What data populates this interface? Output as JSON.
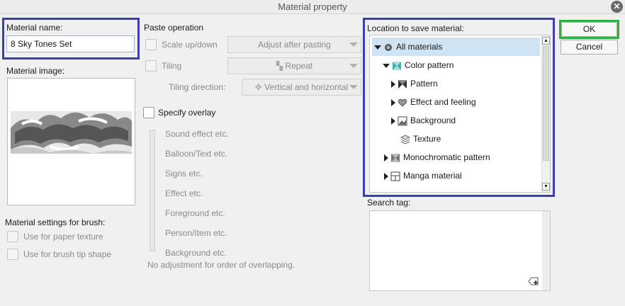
{
  "window": {
    "title": "Material property"
  },
  "material_name": {
    "label": "Material name:",
    "value": "8 Sky Tones Set"
  },
  "material_image": {
    "label": "Material image:"
  },
  "brush_settings": {
    "label": "Material settings for brush:",
    "paper_texture": "Use for paper texture",
    "brush_tip": "Use for brush tip shape"
  },
  "paste": {
    "label": "Paste operation",
    "scale_label": "Scale up/down",
    "scale_dropdown": "Adjust after pasting",
    "tiling_label": "Tiling",
    "tiling_dropdown": "Repeat",
    "direction_label": "Tiling direction:",
    "direction_dropdown": "Vertical and horizontal"
  },
  "overlay": {
    "label": "Specify overlay",
    "items": [
      "Sound effect etc.",
      "Balloon/Text etc.",
      "Signs etc.",
      "Effect etc.",
      "Foreground etc.",
      "Person/Item etc.",
      "Background etc."
    ],
    "note": "No adjustment for order of overlapping."
  },
  "location": {
    "label": "Location to save material:",
    "tree": [
      {
        "label": "All materials",
        "icon": "all-materials-icon",
        "selected": true
      },
      {
        "label": "Color pattern",
        "icon": "color-pattern-icon"
      },
      {
        "label": "Pattern",
        "icon": "pattern-icon"
      },
      {
        "label": "Effect and feeling",
        "icon": "heart-icon"
      },
      {
        "label": "Background",
        "icon": "background-icon"
      },
      {
        "label": "Texture",
        "icon": "texture-icon"
      },
      {
        "label": "Monochromatic pattern",
        "icon": "monochromatic-icon"
      },
      {
        "label": "Manga material",
        "icon": "manga-icon"
      }
    ]
  },
  "search_tag": {
    "label": "Search tag:"
  },
  "buttons": {
    "ok": "OK",
    "cancel": "Cancel"
  },
  "colors": {
    "highlight_blue": "#3b3fb0",
    "highlight_green": "#2fae4a",
    "tree_selected": "#cfe3f2"
  }
}
